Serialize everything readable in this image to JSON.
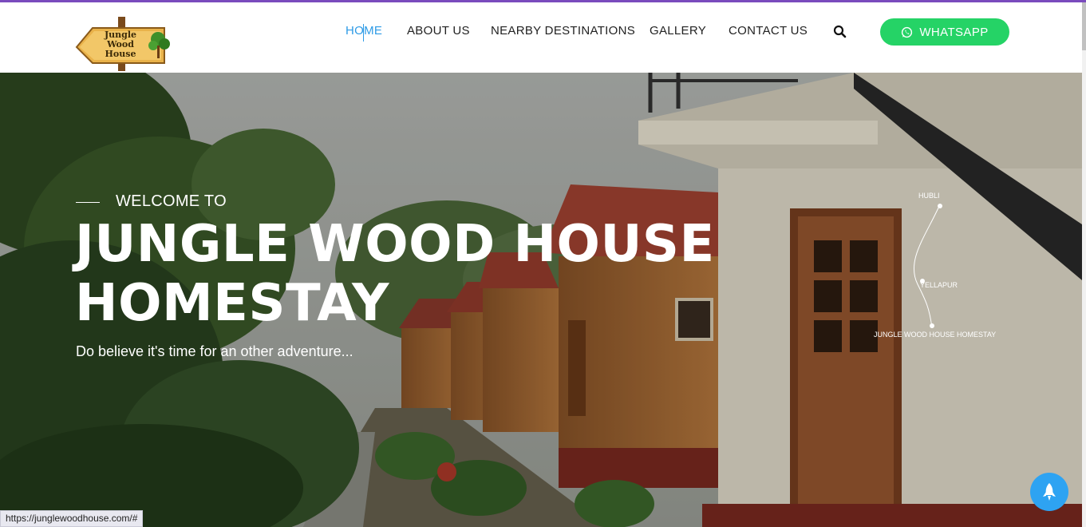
{
  "logo": {
    "line1": "Jungle",
    "line2": "Wood House"
  },
  "nav": {
    "items": [
      {
        "label": "HOME",
        "active": true
      },
      {
        "label": "ABOUT US",
        "active": false
      },
      {
        "label": "NEARBY DESTINATIONS",
        "active": false
      },
      {
        "label": "GALLERY",
        "active": false
      },
      {
        "label": "CONTACT US",
        "active": false
      }
    ],
    "search_icon": "search-icon",
    "whatsapp_label": "WHATSAPP",
    "whatsapp_icon": "whatsapp-icon"
  },
  "hero": {
    "welcome": "WELCOME TO",
    "title_line1": "JUNGLE WOOD HOUSE",
    "title_line2": "HOMESTAY",
    "subtitle": "Do believe it's time for an other adventure...",
    "route": {
      "stop1": "HUBLI",
      "stop2": "YELLAPUR",
      "stop3": "JUNGLE WOOD HOUSE HOMESTAY"
    }
  },
  "status_bar": {
    "url": "https://junglewoodhouse.com/#"
  },
  "scroll_top_icon": "rocket-icon",
  "colors": {
    "accent": "#2e9be6",
    "whatsapp": "#25d366",
    "top_border": "#7a4bbd",
    "nav_text": "#222222"
  }
}
